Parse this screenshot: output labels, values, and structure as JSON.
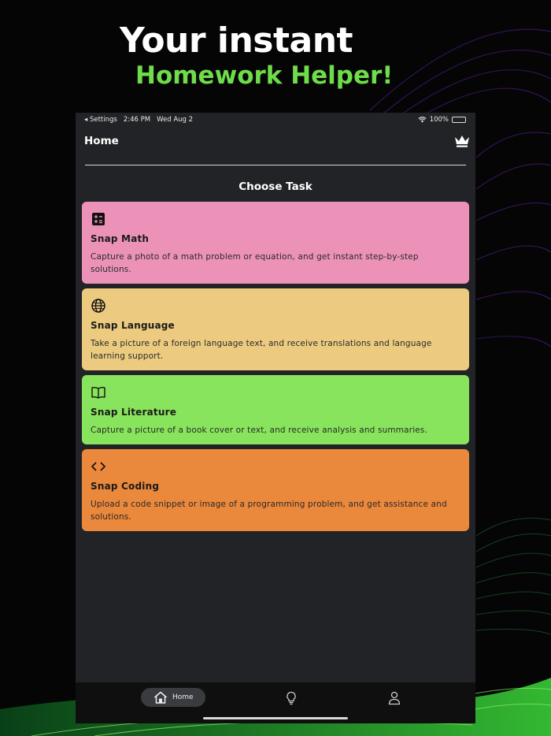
{
  "promo": {
    "title": "Your instant",
    "subtitle": "Homework Helper!"
  },
  "status_bar": {
    "back_app": "◂ Settings",
    "time": "2:46 PM",
    "date": "Wed Aug 2",
    "battery": "100%"
  },
  "nav": {
    "title": "Home",
    "premium_icon": "crown-icon"
  },
  "section_title": "Choose Task",
  "tasks": [
    {
      "title": "Snap Math",
      "description": "Capture a photo of a math problem or equation, and get instant step-by-step solutions.",
      "icon": "calculator-icon",
      "color": "#ec92b8"
    },
    {
      "title": "Snap Language",
      "description": "Take a picture of a foreign language text, and receive translations and language learning support.",
      "icon": "globe-icon",
      "color": "#eccb80"
    },
    {
      "title": "Snap Literature",
      "description": "Capture a picture of a book cover or text, and receive analysis and summaries.",
      "icon": "book-icon",
      "color": "#88e45c"
    },
    {
      "title": "Snap Coding",
      "description": "Upload a code snippet or image of a programming problem, and get assistance and solutions.",
      "icon": "code-icon",
      "color": "#ea883c"
    }
  ],
  "tab_bar": {
    "home_label": "Home",
    "tabs": [
      "home-icon",
      "lightbulb-icon",
      "person-icon"
    ]
  },
  "colors": {
    "accent_green": "#6fdc4a",
    "screen_bg": "#222326",
    "tab_bar_bg": "#0f0f10"
  }
}
